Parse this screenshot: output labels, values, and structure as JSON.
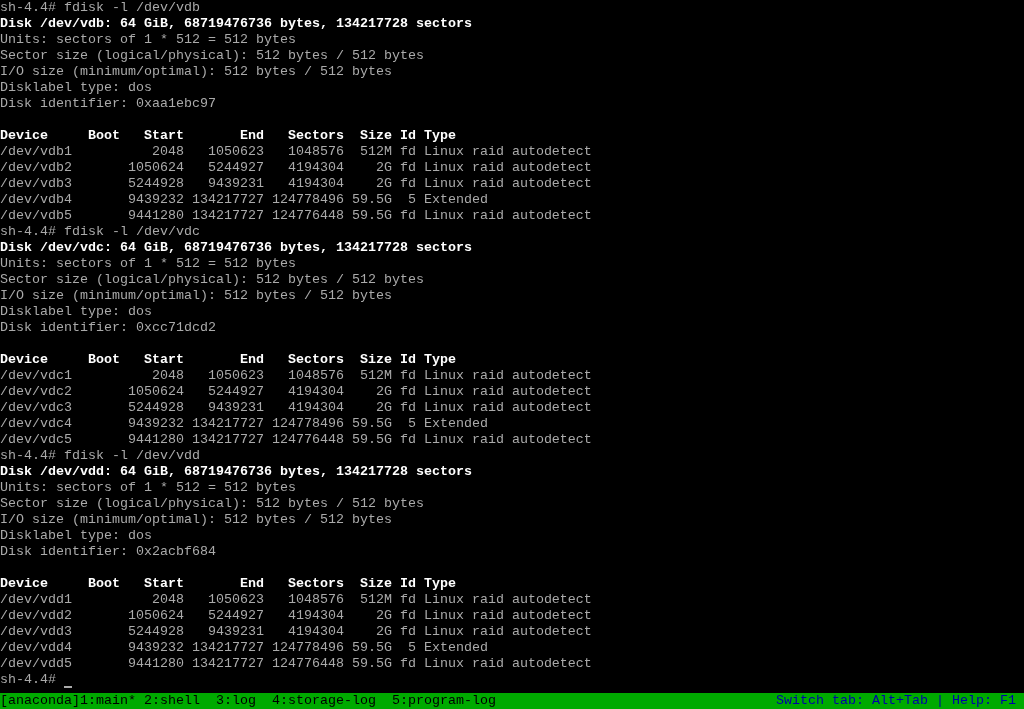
{
  "terminal": {
    "lines": [
      {
        "kind": "prompt",
        "text": "sh-4.4# fdisk -l /dev/vdb"
      },
      {
        "kind": "heading",
        "text": "Disk /dev/vdb: 64 GiB, 68719476736 bytes, 134217728 sectors"
      },
      {
        "kind": "output",
        "text": "Units: sectors of 1 * 512 = 512 bytes"
      },
      {
        "kind": "output",
        "text": "Sector size (logical/physical): 512 bytes / 512 bytes"
      },
      {
        "kind": "output",
        "text": "I/O size (minimum/optimal): 512 bytes / 512 bytes"
      },
      {
        "kind": "output",
        "text": "Disklabel type: dos"
      },
      {
        "kind": "output",
        "text": "Disk identifier: 0xaa1ebc97"
      },
      {
        "kind": "blank"
      },
      {
        "kind": "heading",
        "text": "Device     Boot   Start       End   Sectors  Size Id Type"
      },
      {
        "kind": "output",
        "text": "/dev/vdb1          2048   1050623   1048576  512M fd Linux raid autodetect"
      },
      {
        "kind": "output",
        "text": "/dev/vdb2       1050624   5244927   4194304    2G fd Linux raid autodetect"
      },
      {
        "kind": "output",
        "text": "/dev/vdb3       5244928   9439231   4194304    2G fd Linux raid autodetect"
      },
      {
        "kind": "output",
        "text": "/dev/vdb4       9439232 134217727 124778496 59.5G  5 Extended"
      },
      {
        "kind": "output",
        "text": "/dev/vdb5       9441280 134217727 124776448 59.5G fd Linux raid autodetect"
      },
      {
        "kind": "prompt",
        "text": "sh-4.4# fdisk -l /dev/vdc"
      },
      {
        "kind": "heading",
        "text": "Disk /dev/vdc: 64 GiB, 68719476736 bytes, 134217728 sectors"
      },
      {
        "kind": "output",
        "text": "Units: sectors of 1 * 512 = 512 bytes"
      },
      {
        "kind": "output",
        "text": "Sector size (logical/physical): 512 bytes / 512 bytes"
      },
      {
        "kind": "output",
        "text": "I/O size (minimum/optimal): 512 bytes / 512 bytes"
      },
      {
        "kind": "output",
        "text": "Disklabel type: dos"
      },
      {
        "kind": "output",
        "text": "Disk identifier: 0xcc71dcd2"
      },
      {
        "kind": "blank"
      },
      {
        "kind": "heading",
        "text": "Device     Boot   Start       End   Sectors  Size Id Type"
      },
      {
        "kind": "output",
        "text": "/dev/vdc1          2048   1050623   1048576  512M fd Linux raid autodetect"
      },
      {
        "kind": "output",
        "text": "/dev/vdc2       1050624   5244927   4194304    2G fd Linux raid autodetect"
      },
      {
        "kind": "output",
        "text": "/dev/vdc3       5244928   9439231   4194304    2G fd Linux raid autodetect"
      },
      {
        "kind": "output",
        "text": "/dev/vdc4       9439232 134217727 124778496 59.5G  5 Extended"
      },
      {
        "kind": "output",
        "text": "/dev/vdc5       9441280 134217727 124776448 59.5G fd Linux raid autodetect"
      },
      {
        "kind": "prompt",
        "text": "sh-4.4# fdisk -l /dev/vdd"
      },
      {
        "kind": "heading",
        "text": "Disk /dev/vdd: 64 GiB, 68719476736 bytes, 134217728 sectors"
      },
      {
        "kind": "output",
        "text": "Units: sectors of 1 * 512 = 512 bytes"
      },
      {
        "kind": "output",
        "text": "Sector size (logical/physical): 512 bytes / 512 bytes"
      },
      {
        "kind": "output",
        "text": "I/O size (minimum/optimal): 512 bytes / 512 bytes"
      },
      {
        "kind": "output",
        "text": "Disklabel type: dos"
      },
      {
        "kind": "output",
        "text": "Disk identifier: 0x2acbf684"
      },
      {
        "kind": "blank"
      },
      {
        "kind": "heading",
        "text": "Device     Boot   Start       End   Sectors  Size Id Type"
      },
      {
        "kind": "output",
        "text": "/dev/vdd1          2048   1050623   1048576  512M fd Linux raid autodetect"
      },
      {
        "kind": "output",
        "text": "/dev/vdd2       1050624   5244927   4194304    2G fd Linux raid autodetect"
      },
      {
        "kind": "output",
        "text": "/dev/vdd3       5244928   9439231   4194304    2G fd Linux raid autodetect"
      },
      {
        "kind": "output",
        "text": "/dev/vdd4       9439232 134217727 124778496 59.5G  5 Extended"
      },
      {
        "kind": "output",
        "text": "/dev/vdd5       9441280 134217727 124776448 59.5G fd Linux raid autodetect"
      },
      {
        "kind": "cursor",
        "text": "sh-4.4#"
      }
    ]
  },
  "status_bar": {
    "session": "[anaconda]",
    "windows": [
      "1:main*",
      "2:shell",
      "3:log",
      "4:storage-log",
      "5:program-log"
    ],
    "hint": "Switch tab: Alt+Tab | Help: F1"
  }
}
